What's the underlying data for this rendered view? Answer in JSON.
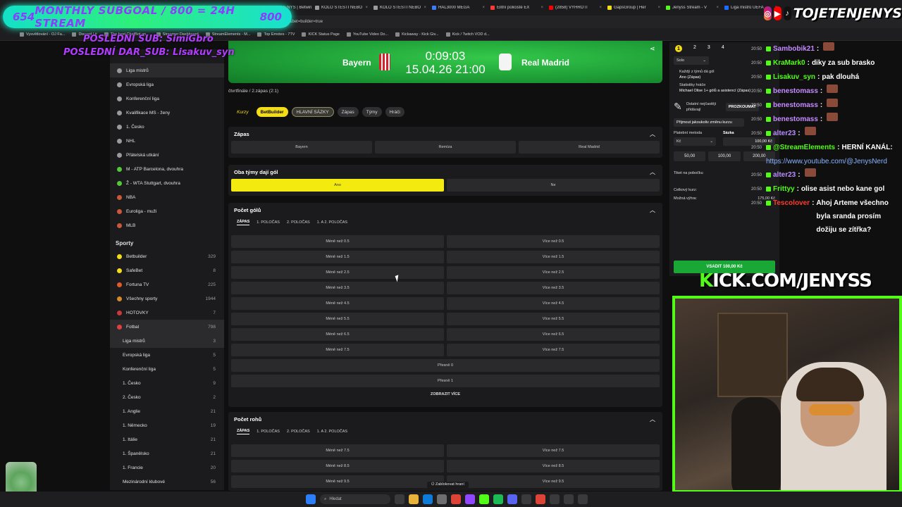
{
  "browser": {
    "tabs": [
      {
        "label": "TOJETENJENYS | Betwin",
        "color": "#ff3b30"
      },
      {
        "label": "KOLO ŠTĚSTÍ NEBO",
        "color": "#9b9b9b"
      },
      {
        "label": "KOLO ŠTĚSTÍ NEBO",
        "color": "#9b9b9b"
      },
      {
        "label": "HAL3000 MEGA",
        "color": "#3a7bff"
      },
      {
        "label": "Elitní policisté EX",
        "color": "#ff3b30"
      },
      {
        "label": "(2858) VYHROTI",
        "color": "#ff0000"
      },
      {
        "label": "GapsGroup | Her",
        "color": "#f3dc18"
      },
      {
        "label": "Jenyss Stream - V",
        "color": "#53fc18"
      },
      {
        "label": "Liga mistrů UEFA",
        "color": "#1e6cff"
      }
    ],
    "address": "...=all&tab=one&bet=builder=true",
    "bookmarks": [
      "Vysvětlování - OJ Fa...",
      "Discord | #",
      "The best ChatBot an...",
      "Streamer Dashboard",
      "StreamElements - M...",
      "Top Emotes - 7TV",
      "KICK Status Page",
      "YouTube Video Do...",
      "Kickaway - Kick Giv...",
      "Kick / Twitch VOD d..."
    ]
  },
  "overlay": {
    "subgoal_left": "654",
    "subgoal_text": "MONTHLY SUBGOAL / 800 = 24H STREAM",
    "subgoal_right": "800",
    "last_sub": "POSLEDNÍ SUB: SimiGbro",
    "last_gift": "POSLEDNÍ DAR_SUB: Lisakuv_syn",
    "handle": "TOJETENJENYS",
    "kick_url_k": "K",
    "kick_url_rest": "ICK.COM/JENYSS"
  },
  "sidebar": {
    "top_items": [
      {
        "label": "Liga mistrů",
        "active": true
      },
      {
        "label": "Evropská liga"
      },
      {
        "label": "Konferenční liga"
      },
      {
        "label": "Kvalifikace MS - ženy"
      },
      {
        "label": "1. Česko"
      },
      {
        "label": "NHL"
      },
      {
        "label": "Přátelská utkání"
      },
      {
        "label": "M - ATP Barcelona, dvouhra"
      },
      {
        "label": "Ž - WTA Stuttgart, dvouhra"
      },
      {
        "label": "NBA"
      },
      {
        "label": "Euroliga - muži"
      },
      {
        "label": "MLB"
      }
    ],
    "heading": "Sporty",
    "sports": [
      {
        "label": "Betbuilder",
        "count": "329"
      },
      {
        "label": "SafeBet",
        "count": "8"
      },
      {
        "label": "Fortuna TV",
        "count": "225"
      },
      {
        "label": "Všechny sporty",
        "count": "1944"
      },
      {
        "label": "HOTOVKY",
        "count": "7"
      },
      {
        "label": "Fotbal",
        "count": "798"
      }
    ],
    "football_leagues": [
      {
        "label": "Liga mistrů",
        "count": "3",
        "active": true
      },
      {
        "label": "Evropská liga",
        "count": "5"
      },
      {
        "label": "Konferenční liga",
        "count": "5"
      },
      {
        "label": "1. Česko",
        "count": "9"
      },
      {
        "label": "2. Česko",
        "count": "2"
      },
      {
        "label": "1. Anglie",
        "count": "21"
      },
      {
        "label": "1. Německo",
        "count": "19"
      },
      {
        "label": "1. Itálie",
        "count": "21"
      },
      {
        "label": "1. Španělsko",
        "count": "21"
      },
      {
        "label": "1. Francie",
        "count": "20"
      },
      {
        "label": "Mezinárodní klubové",
        "count": "56"
      }
    ]
  },
  "match": {
    "home": "Bayern",
    "away": "Real Madrid",
    "clock": "0:09:03",
    "datetime": "15.04.26 21:00",
    "breadcrumb": "čtvrtfinále / 2.zápas (2:1)"
  },
  "filters": [
    "Kurzy",
    "BetBuilder",
    "HLAVNÍ SÁZKY",
    "Zápas",
    "Týmy",
    "Hráči"
  ],
  "markets": {
    "zapas": {
      "title": "Zápas",
      "options": [
        "Bayern",
        "Remíza",
        "Real Madrid"
      ]
    },
    "oba_daji": {
      "title": "Oba týmy dají gól",
      "options": [
        "Ano",
        "Ne"
      ]
    },
    "pocet_golu": {
      "title": "Počet gólů",
      "tabs": [
        "ZÁPAS",
        "1. POLOČAS",
        "2. POLOČAS",
        "1. A 2. POLOČAS"
      ],
      "rows": [
        [
          "Méně než 0.5",
          "Více než 0.5"
        ],
        [
          "Méně než 1.5",
          "Více než 1.5"
        ],
        [
          "Méně než 2.5",
          "Více než 2.5"
        ],
        [
          "Méně než 3.5",
          "Více než 3.5"
        ],
        [
          "Méně než 4.5",
          "Více než 4.5"
        ],
        [
          "Méně než 5.5",
          "Více než 5.5"
        ],
        [
          "Méně než 6.5",
          "Více než 6.5"
        ],
        [
          "Méně než 7.5",
          "Více než 7.5"
        ]
      ],
      "exact": [
        "Přesně 0",
        "Přesně 1"
      ],
      "more": "ZOBRAZIT VÍCE"
    },
    "pocet_rohu": {
      "title": "Počet rohů",
      "tabs": [
        "ZÁPAS",
        "1. POLOČAS",
        "2. POLOČAS",
        "1. A 2. POLOČAS"
      ],
      "rows": [
        [
          "Méně než 7.5",
          "Více než 7.5"
        ],
        [
          "Méně než 8.5",
          "Více než 8.5"
        ],
        [
          "Méně než 9.5",
          "Více než 9.5"
        ]
      ]
    }
  },
  "lock_button": "Zablokovat hraní",
  "betslip": {
    "tabs": [
      "1",
      "2",
      "3",
      "4"
    ],
    "type": "Solo",
    "line1": "Každý z týmů dá gól",
    "line1b": "Ano (Zápas)",
    "line2": "Statistiky hráče",
    "line2b": "Michael Olise 1+ gólů a asistencí (Zápas)",
    "promo": "Ostatní nejčastěji přidávají",
    "promo_btn": "PROZKOUMAT",
    "accept": "Přijmout jakoukoliv změnu kurzu",
    "method_label": "Platební metoda",
    "method_value": "Kč",
    "stake_label": "Sázka",
    "stake_value": "100,00 Kč",
    "amounts": [
      "50,00",
      "100,00",
      "200,00"
    ],
    "branch": "Tiket na pobočku",
    "total_odds": "Celkový kurz:",
    "possible_win": "Možná výhra:",
    "possible_win_value": "175,00 Kč",
    "place_btn": "VSADIT 100,00 Kč"
  },
  "chat": [
    {
      "ts": "20:50",
      "user": "Sambobik21",
      "color": "#c58cff",
      "msg": "",
      "emote": true
    },
    {
      "ts": "20:50",
      "user": "KraMark0",
      "color": "#53fc18",
      "msg": "diky za sub brasko"
    },
    {
      "ts": "20:50",
      "user": "Lisakuv_syn",
      "color": "#53fc18",
      "msg": "pak dlouhá"
    },
    {
      "ts": "20:50",
      "user": "benestomass",
      "color": "#c58cff",
      "msg": "",
      "emote": true
    },
    {
      "ts": "20:50",
      "user": "benestomass",
      "color": "#c58cff",
      "msg": "",
      "emote": true
    },
    {
      "ts": "20:50",
      "user": "benestomass",
      "color": "#c58cff",
      "msg": "",
      "emote": true
    },
    {
      "ts": "20:50",
      "user": "alter23",
      "color": "#b98cff",
      "msg": "",
      "emote": true
    },
    {
      "ts": "20:50",
      "user": "@StreamElements",
      "color": "#53fc18",
      "msg": "HERNÍ KANÁL:"
    },
    {
      "ts": "",
      "user": "",
      "color": "#ffffff",
      "msg": "https://www.youtube.com/@JenysNerd",
      "link": true
    },
    {
      "ts": "20:50",
      "user": "alter23",
      "color": "#b98cff",
      "msg": "",
      "emote": true
    },
    {
      "ts": "20:50",
      "user": "Frittyy",
      "color": "#53fc18",
      "msg": "olise asist nebo kane gol"
    },
    {
      "ts": "20:50",
      "user": "Tescolover",
      "color": "#ff3b30",
      "msg": "Ahoj Arteme všechno byla sranda prosím dožiju se zítřka?"
    }
  ],
  "taskbar": {
    "search": "Hledat"
  },
  "colors": {
    "accent_yellow": "#f3dc18",
    "kick_green": "#53fc18",
    "bet_green": "#19a836"
  }
}
